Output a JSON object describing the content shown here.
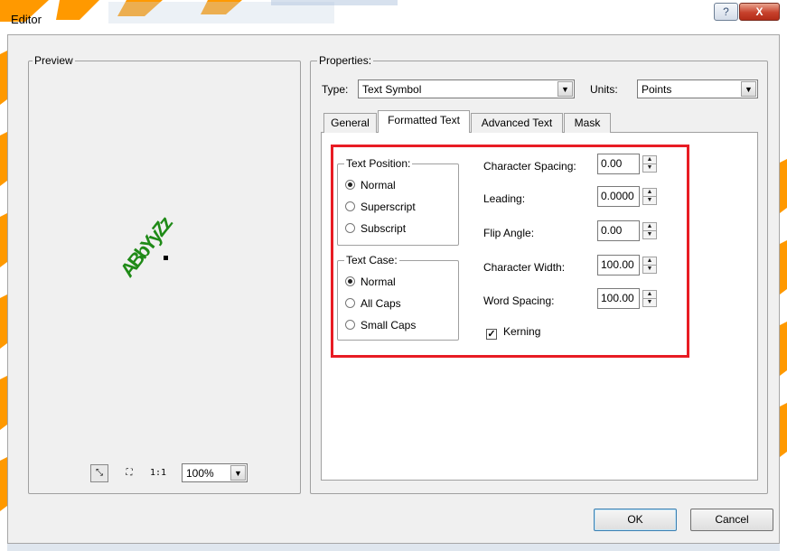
{
  "window": {
    "title": "Editor",
    "help_label": "?",
    "close_label": "X"
  },
  "preview": {
    "group_label": "Preview",
    "sample_text": "ABbYyZz",
    "tools": [
      {
        "name": "fit-icon",
        "glyph": "⤡"
      },
      {
        "name": "fullextent-icon",
        "glyph": "⛶"
      },
      {
        "name": "actual-size-icon",
        "glyph": "1:1"
      }
    ],
    "zoom": {
      "value": "100%",
      "arrow": "▼"
    }
  },
  "properties": {
    "group_label": "Properties:",
    "type_label": "Type:",
    "type_value": "Text Symbol",
    "units_label": "Units:",
    "units_value": "Points",
    "arrow": "▼",
    "tabs": [
      {
        "label": "General"
      },
      {
        "label": "Formatted Text"
      },
      {
        "label": "Advanced Text"
      },
      {
        "label": "Mask"
      }
    ]
  },
  "formatted_text": {
    "text_position": {
      "label": "Text Position:",
      "options": [
        {
          "label": "Normal",
          "selected": true
        },
        {
          "label": "Superscript",
          "selected": false
        },
        {
          "label": "Subscript",
          "selected": false
        }
      ]
    },
    "text_case": {
      "label": "Text Case:",
      "options": [
        {
          "label": "Normal",
          "selected": true
        },
        {
          "label": "All Caps",
          "selected": false
        },
        {
          "label": "Small Caps",
          "selected": false
        }
      ]
    },
    "fields": [
      {
        "label": "Character Spacing:",
        "value": "0.00"
      },
      {
        "label": "Leading:",
        "value": "0.0000"
      },
      {
        "label": "Flip Angle:",
        "value": "0.00"
      },
      {
        "label": "Character Width:",
        "value": "100.00"
      },
      {
        "label": "Word Spacing:",
        "value": "100.00"
      }
    ],
    "spin_up": "▲",
    "spin_down": "▼",
    "kerning": {
      "label": "Kerning",
      "checked": true,
      "mark": "✓"
    }
  },
  "buttons": {
    "ok": "OK",
    "cancel": "Cancel"
  },
  "colors": {
    "highlight": "#e81c24",
    "sample_text": "#1f8a17"
  }
}
